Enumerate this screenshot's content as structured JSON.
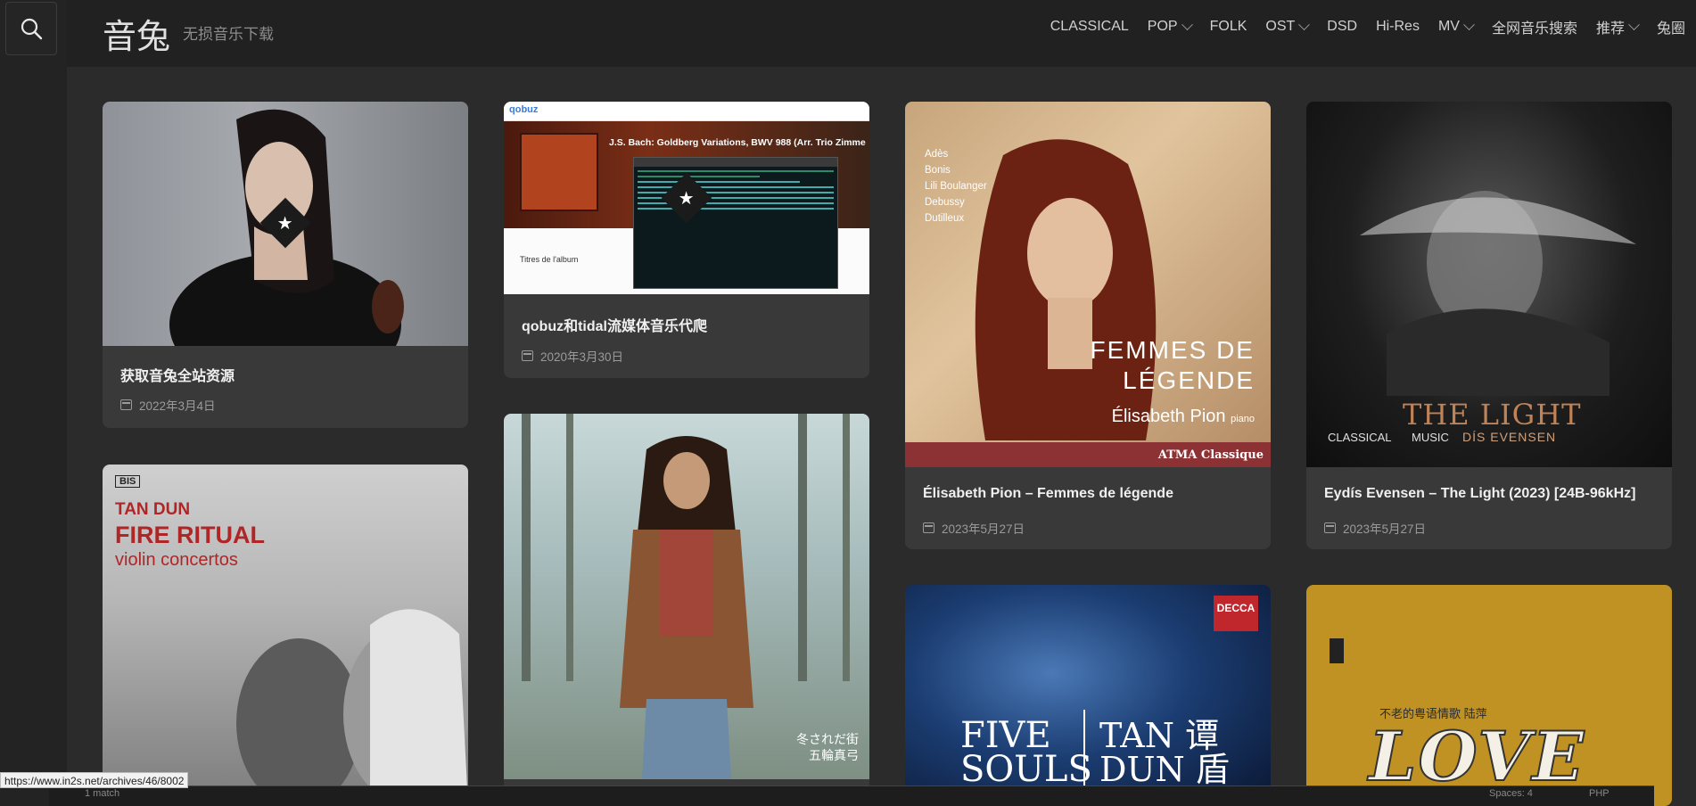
{
  "site": {
    "logo": "音兔",
    "tagline": "无损音乐下载"
  },
  "nav": {
    "items": [
      {
        "label": "CLASSICAL",
        "dropdown": false
      },
      {
        "label": "POP",
        "dropdown": true
      },
      {
        "label": "FOLK",
        "dropdown": false
      },
      {
        "label": "OST",
        "dropdown": true
      },
      {
        "label": "DSD",
        "dropdown": false
      },
      {
        "label": "Hi-Res",
        "dropdown": false
      },
      {
        "label": "MV",
        "dropdown": true
      },
      {
        "label": "全网音乐搜索",
        "dropdown": false
      },
      {
        "label": "推荐",
        "dropdown": true
      },
      {
        "label": "兔圈",
        "dropdown": false
      }
    ]
  },
  "posts": [
    {
      "title": "获取音兔全站资源",
      "date": "2022年3月4日"
    },
    {
      "title": "qobuz和tidal流媒体音乐代爬",
      "date": "2020年3月30日"
    },
    {
      "title": "Élisabeth Pion – Femmes de légende",
      "date": "2023年5月27日"
    },
    {
      "title": "Eydís Evensen – The Light (2023) [24B-96kHz]",
      "date": "2023年5月27日"
    }
  ],
  "thumb_text": {
    "qobuz_logo": "qobuz",
    "qobuz_album": "J.S. Bach: Goldberg Variations, BWV 988 (Arr. Trio Zimme",
    "qobuz_section": "Titres de l'album",
    "femmes_composers": [
      "Adès",
      "Bonis",
      "Lili Boulanger",
      "Debussy",
      "Dutilleux"
    ],
    "femmes_title1": "FEMMES DE",
    "femmes_title2": "LÉGENDE",
    "femmes_artist": "Élisabeth Pion",
    "femmes_instrument": "piano",
    "femmes_label": "ATMA Classique",
    "light_title": "THE LIGHT",
    "light_artist": "DÍS EVENSEN",
    "light_tag1": "CLASSICAL",
    "light_tag2": "MUSIC",
    "tandun_label": "BIS",
    "tandun_name": "TAN DUN",
    "tandun_title": "FIRE RITUAL",
    "tandun_sub": "violin concertos",
    "wulun_text1": "冬されだ街",
    "wulun_text2": "五輪真弓",
    "five_decca": "DECCA",
    "five_text1": "FIVE",
    "five_text2": "SOULS",
    "five_tan": "TAN 谭",
    "five_dun": "DUN 盾",
    "love_sub": "不老的粤语情歌 陆萍",
    "love_title": "LOVE"
  },
  "status_url": "https://www.in2s.net/archives/46/8002",
  "bottom_text": {
    "left": "1 match",
    "right1": "Spaces: 4",
    "right2": "PHP"
  },
  "colors": {
    "background": "#2b2b2b",
    "card": "#393939",
    "header": "#212121"
  }
}
